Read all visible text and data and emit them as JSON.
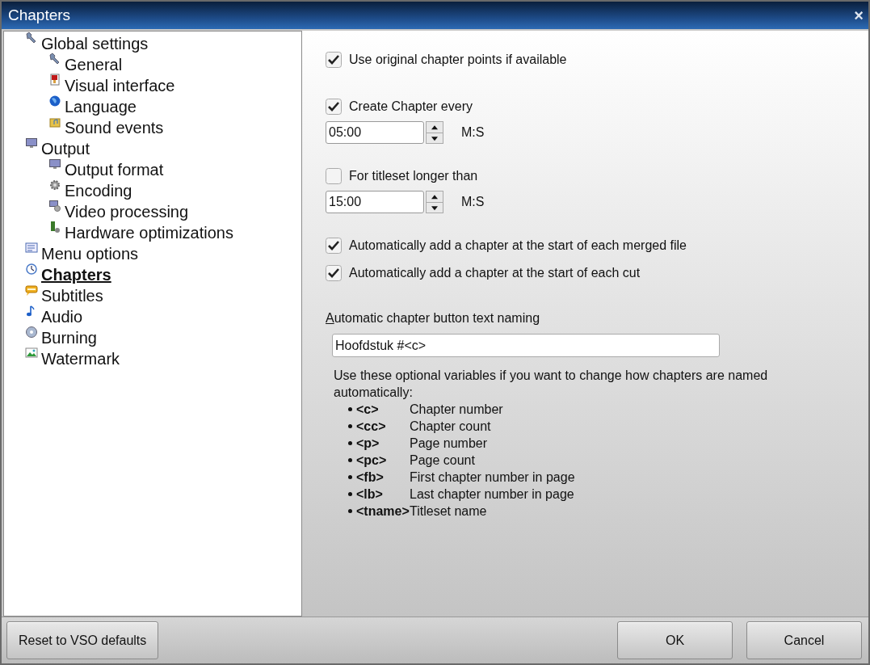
{
  "window": {
    "title": "Chapters",
    "close": "×"
  },
  "sidebar": {
    "items": [
      {
        "label": "Global settings",
        "selected": false,
        "children": [
          {
            "label": "General",
            "selected": false
          },
          {
            "label": "Visual interface",
            "selected": false
          },
          {
            "label": "Language",
            "selected": false
          },
          {
            "label": "Sound events",
            "selected": false
          }
        ]
      },
      {
        "label": "Output",
        "selected": false,
        "children": [
          {
            "label": "Output format",
            "selected": false
          },
          {
            "label": "Encoding",
            "selected": false
          },
          {
            "label": "Video processing",
            "selected": false
          },
          {
            "label": "Hardware optimizations",
            "selected": false
          }
        ]
      },
      {
        "label": "Menu options",
        "selected": false
      },
      {
        "label": "Chapters",
        "selected": true
      },
      {
        "label": "Subtitles",
        "selected": false
      },
      {
        "label": "Audio",
        "selected": false
      },
      {
        "label": "Burning",
        "selected": false
      },
      {
        "label": "Watermark",
        "selected": false
      }
    ]
  },
  "option_groups": [
    [
      {
        "kind": "checkbox",
        "label": "Use original chapter points if available",
        "checked": true
      }
    ],
    [
      {
        "kind": "checkbox",
        "label": "Create Chapter every",
        "checked": true
      },
      {
        "kind": "spinner",
        "value": "05:00",
        "unit": "M:S"
      }
    ],
    [
      {
        "kind": "checkbox",
        "label": "For titleset longer than",
        "checked": false
      },
      {
        "kind": "spinner",
        "value": "15:00",
        "unit": "M:S"
      }
    ],
    [
      {
        "kind": "checkbox",
        "label": "Automatically add a chapter at the start of each merged file",
        "checked": true
      },
      {
        "kind": "checkbox",
        "label": "Automatically add a chapter at the start of each cut",
        "checked": true
      }
    ]
  ],
  "naming": {
    "label": "Automatic chapter button text naming",
    "value": "Hoofdstuk #<c>",
    "help": "Use these optional variables if you want to change how chapters are named automatically:",
    "variables": [
      {
        "name": "<c>",
        "description": "Chapter number"
      },
      {
        "name": "<cc>",
        "description": "Chapter count"
      },
      {
        "name": "<p>",
        "description": "Page number"
      },
      {
        "name": "<pc>",
        "description": "Page count"
      },
      {
        "name": "<fb>",
        "description": "First chapter number in page"
      },
      {
        "name": "<lb>",
        "description": "Last chapter number in page"
      },
      {
        "name": "<tname>",
        "description": "Titleset name"
      }
    ]
  },
  "buttons": {
    "left": [
      "Reset to VSO defaults"
    ],
    "right": [
      "OK",
      "Cancel"
    ]
  }
}
